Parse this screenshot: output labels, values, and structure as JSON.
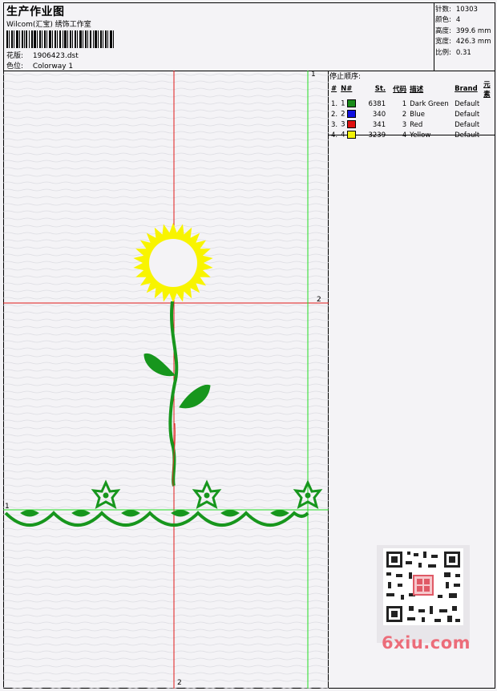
{
  "header": {
    "title": "生产作业图",
    "studio": "Wilcom(汇宝) 绣饰工作室",
    "design_label": "花版:",
    "design_value": "1906423.dst",
    "colorway_label": "色位:",
    "colorway_value": "Colorway 1"
  },
  "stats": [
    {
      "label": "针数:",
      "value": "10303"
    },
    {
      "label": "颜色:",
      "value": "4"
    },
    {
      "label": "高度:",
      "value": "399.6 mm"
    },
    {
      "label": "宽度:",
      "value": "426.3 mm"
    },
    {
      "label": "比例:",
      "value": "0.31"
    }
  ],
  "palette": {
    "title": "停止顺序:",
    "headers": [
      "#",
      "N#",
      "St.",
      "代码",
      "描述",
      "Brand",
      "元素"
    ],
    "rows": [
      {
        "idx": "1.",
        "n": "1",
        "color": "#1a8c1a",
        "st": "6381",
        "code": "1",
        "desc": "Dark Green",
        "brand": "Default"
      },
      {
        "idx": "2.",
        "n": "2",
        "color": "#1010e0",
        "st": "340",
        "code": "2",
        "desc": "Blue",
        "brand": "Default"
      },
      {
        "idx": "3.",
        "n": "3",
        "color": "#e01010",
        "st": "341",
        "code": "3",
        "desc": "Red",
        "brand": "Default"
      },
      {
        "idx": "4.",
        "n": "4",
        "color": "#f2f20a",
        "st": "3239",
        "code": "4",
        "desc": "Yellow",
        "brand": "Default"
      }
    ]
  },
  "guides": {
    "top_label": "1",
    "right_label": "2",
    "left_label": "1",
    "bottom_label": "2"
  },
  "colors": {
    "green_guide": "#22dd22",
    "red_guide": "#e01818",
    "thread_green": "#17961d",
    "thread_yellow": "#f8f400"
  },
  "watermark": {
    "text": "6xiu.com"
  },
  "icons": {
    "qr": "qr-code-icon",
    "barcode": "barcode-icon",
    "seal": "seal-icon"
  }
}
